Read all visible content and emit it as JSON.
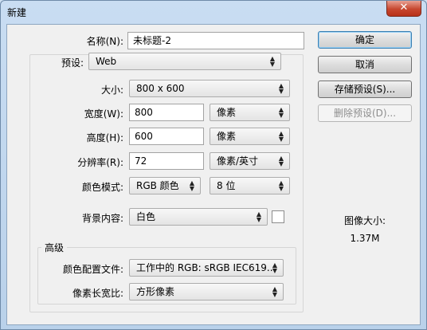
{
  "window": {
    "title": "新建",
    "close_glyph": "✕"
  },
  "form": {
    "name": {
      "label": "名称(N):",
      "value": "未标题-2"
    },
    "preset": {
      "label": "预设:",
      "value": "Web"
    },
    "size": {
      "label": "大小:",
      "value": "800 x 600"
    },
    "width": {
      "label": "宽度(W):",
      "value": "800",
      "unit": "像素"
    },
    "height": {
      "label": "高度(H):",
      "value": "600",
      "unit": "像素"
    },
    "resolution": {
      "label": "分辨率(R):",
      "value": "72",
      "unit": "像素/英寸"
    },
    "color_mode": {
      "label": "颜色模式:",
      "value": "RGB 颜色",
      "depth": "8 位"
    },
    "background": {
      "label": "背景内容:",
      "value": "白色",
      "swatch_color": "#ffffff"
    },
    "advanced": {
      "title": "高级",
      "color_profile": {
        "label": "颜色配置文件:",
        "value": "工作中的 RGB: sRGB IEC619..."
      },
      "pixel_aspect": {
        "label": "像素长宽比:",
        "value": "方形像素"
      }
    }
  },
  "buttons": {
    "ok": "确定",
    "cancel": "取消",
    "save_preset": "存储预设(S)...",
    "delete_preset": "删除预设(D)..."
  },
  "image_size": {
    "label": "图像大小:",
    "value": "1.37M"
  },
  "icons": {
    "dropdown": "up-down-arrows-icon",
    "close": "close-icon"
  },
  "colors": {
    "dialog_bg": "#f0f0f0",
    "close_red": "#c7472f",
    "default_button_border": "#3c7fb1"
  }
}
